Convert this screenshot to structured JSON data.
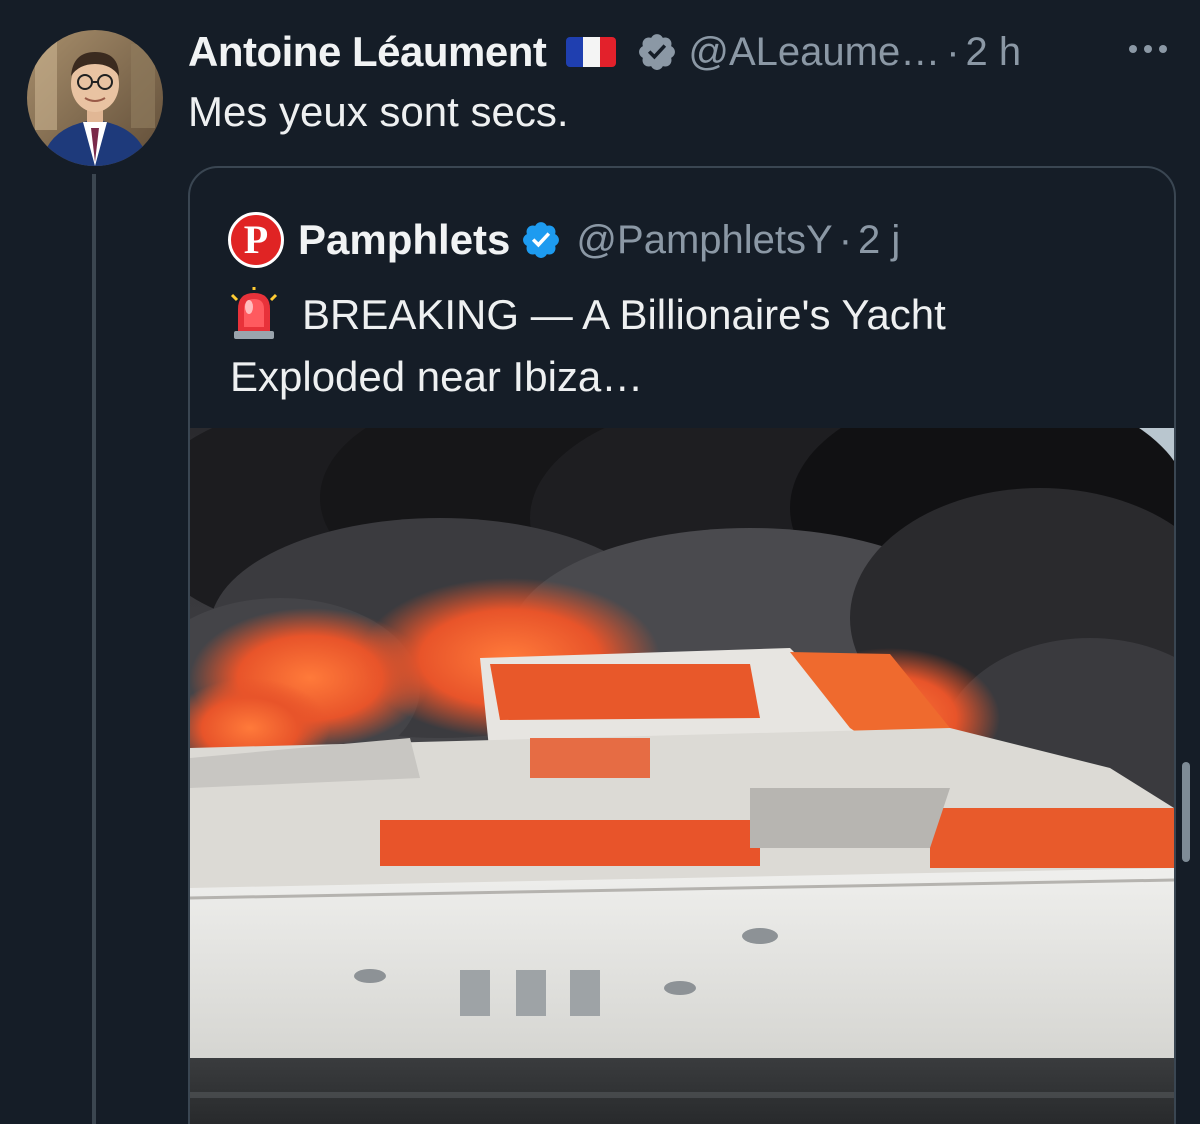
{
  "tweet": {
    "author_name": "Antoine Léaument",
    "flag_icon": "france-flag-icon",
    "handle": "@ALeaume…",
    "separator": "·",
    "time": "2 h",
    "text": "Mes yeux sont secs."
  },
  "quote": {
    "logo_letter": "P",
    "author_name": "Pamphlets",
    "handle": "@PamphletsY",
    "separator": "·",
    "time": "2 j",
    "emoji_icon": "police-siren-icon",
    "text": "BREAKING — A Billionaire's Yacht Exploded near Ibiza…"
  },
  "colors": {
    "background": "#151d27",
    "verified_blue": "#1d9bf0",
    "verified_gray": "#8b98a5",
    "brand_red": "#e02424",
    "muted_text": "#8b98a5"
  }
}
